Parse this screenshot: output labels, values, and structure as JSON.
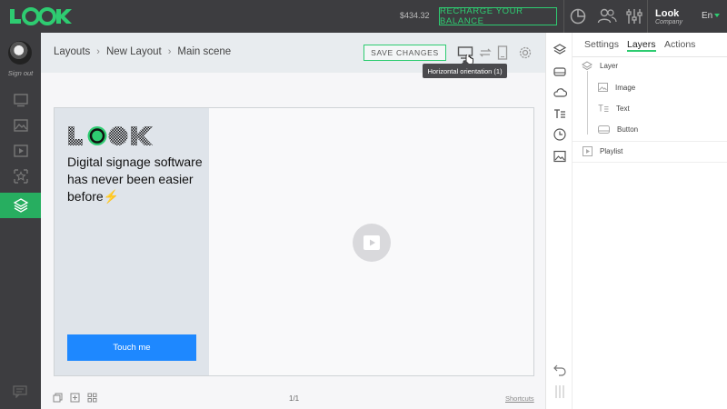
{
  "app": {
    "logo_text": "LOOK",
    "balance": "$434.32",
    "recharge_label": "RECHARGE YOUR BALANCE",
    "user_name": "Look",
    "user_company": "Company",
    "language": "En",
    "accent_color": "#2ecc71"
  },
  "sidebar": {
    "signout_label": "Sign out",
    "items": [
      {
        "icon": "screen-icon",
        "active": false
      },
      {
        "icon": "image-icon",
        "active": false
      },
      {
        "icon": "video-icon",
        "active": false
      },
      {
        "icon": "widget-icon",
        "active": false
      },
      {
        "icon": "layers-icon",
        "active": true
      }
    ]
  },
  "header": {
    "breadcrumb": [
      "Layouts",
      "New Layout",
      "Main scene"
    ],
    "save_label": "SAVE CHANGES",
    "tooltip": "Horizontal orientation (1)"
  },
  "scene": {
    "promo_text": "Digital signage software has never been easier before⚡",
    "button_label": "Touch me"
  },
  "footer": {
    "pager": "1/1",
    "shortcuts_label": "Shortcuts"
  },
  "panel": {
    "tabs": [
      "Settings",
      "Layers",
      "Actions"
    ],
    "active_tab": "Layers",
    "layers": {
      "root": "Layer",
      "children": [
        "Image",
        "Text",
        "Button"
      ],
      "playlist": "Playlist"
    }
  }
}
